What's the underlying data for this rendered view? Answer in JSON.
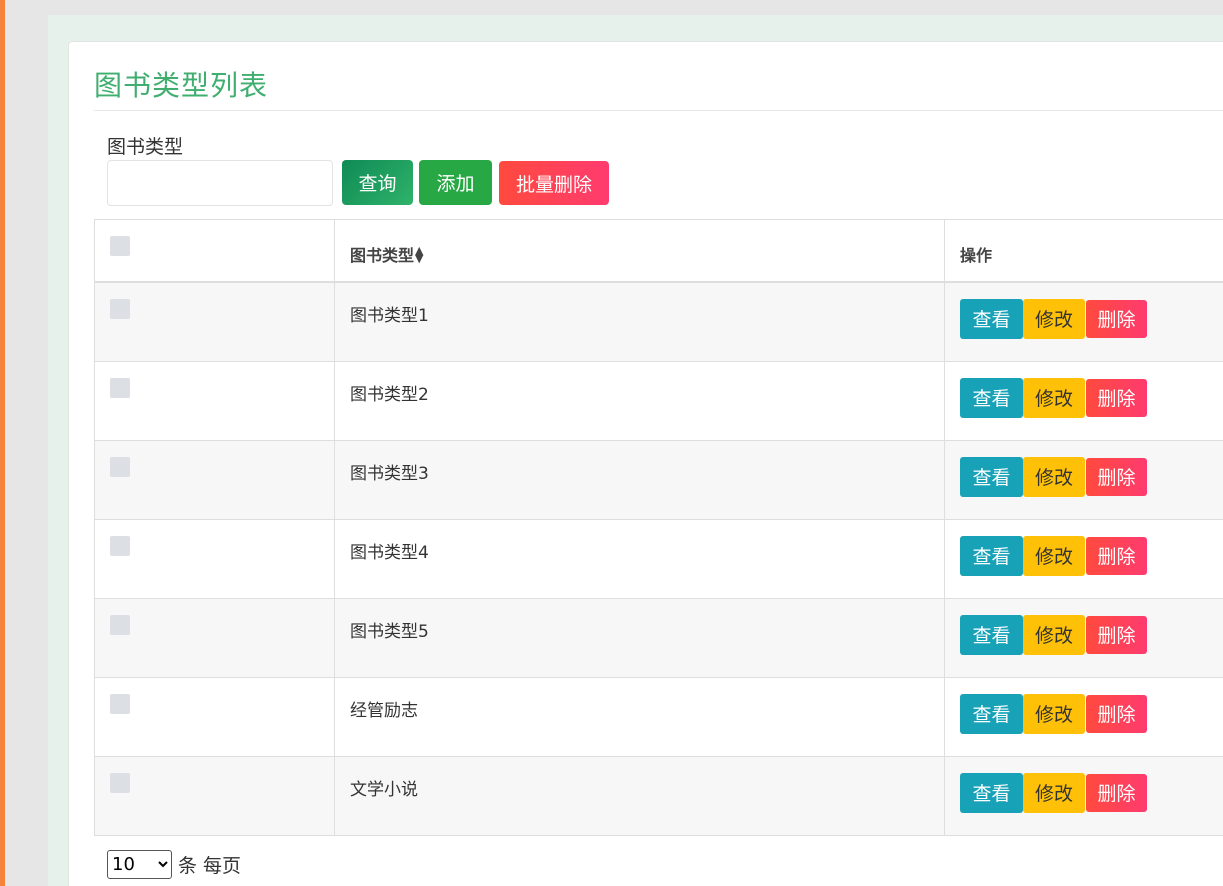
{
  "page": {
    "title": "图书类型列表"
  },
  "search": {
    "label": "图书类型",
    "value": "",
    "placeholder": ""
  },
  "toolbar": {
    "query_label": "查询",
    "add_label": "添加",
    "batch_delete_label": "批量删除"
  },
  "table": {
    "columns": [
      "",
      "图书类型",
      "操作"
    ],
    "sort_icon": "sort-icon",
    "rows": [
      {
        "type": "图书类型1"
      },
      {
        "type": "图书类型2"
      },
      {
        "type": "图书类型3"
      },
      {
        "type": "图书类型4"
      },
      {
        "type": "图书类型5"
      },
      {
        "type": "经管励志"
      },
      {
        "type": "文学小说"
      }
    ],
    "actions": {
      "view": "查看",
      "edit": "修改",
      "delete": "删除"
    }
  },
  "pagination": {
    "page_size": "10",
    "page_size_options": [
      "10"
    ],
    "suffix": "条 每页"
  },
  "colors": {
    "title": "#3fae6e",
    "view": "#17a2b8",
    "edit": "#ffc107",
    "delete": "#ff4a3e",
    "add": "#28a745",
    "accent_bar": "#f5843a"
  }
}
